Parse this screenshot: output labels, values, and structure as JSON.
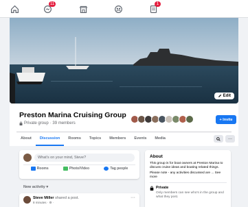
{
  "topnav": {
    "icons": [
      "home-icon",
      "messenger-icon",
      "marketplace-icon",
      "groups-icon",
      "notifications-icon"
    ],
    "messages_badge": "11",
    "notifications_badge": "1"
  },
  "cover": {
    "edit_label": "Edit"
  },
  "group": {
    "title": "Preston Marina Cruising Group",
    "privacy": "Private group",
    "members": "· 39 members",
    "invite_label": "+ Invite"
  },
  "tabs": [
    "About",
    "Discussion",
    "Rooms",
    "Topics",
    "Members",
    "Events",
    "Media"
  ],
  "active_tab": "Discussion",
  "composer": {
    "placeholder": "What's on your mind, Steve?",
    "rooms": "Rooms",
    "photo_video": "Photo/Video",
    "tag_people": "Tag people"
  },
  "feed": {
    "sort_label": "New activity ▾",
    "post_author": "Steve Miller",
    "post_action": " shared a post.",
    "post_time": "8 minutes · ⚙ ·"
  },
  "about": {
    "title": "About",
    "description": "This group is for boat owners at Preston Marina to discuss cruise ideas and boating related things.",
    "note": "Please note - any activities discussed are ... See more",
    "privacy_label": "Private",
    "privacy_desc": "Only members can see who's in the group and what they post."
  },
  "colors": {
    "brand": "#1877f2",
    "badge": "#e41e3f"
  }
}
